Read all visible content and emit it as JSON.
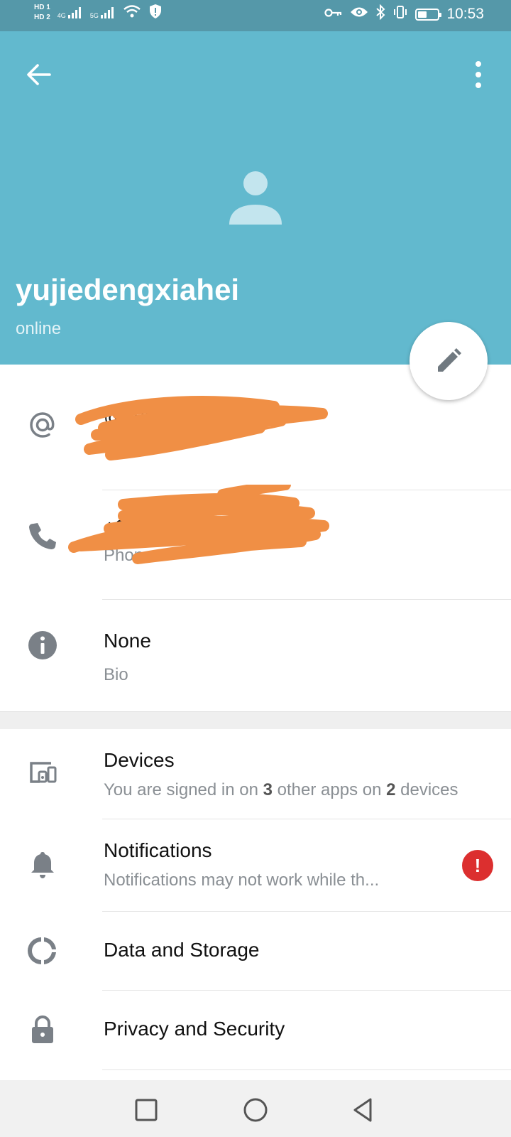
{
  "status_bar": {
    "time": "10:53",
    "hd1": "HD 1",
    "hd2": "HD 2",
    "net1": "4G",
    "net2": "5G"
  },
  "profile": {
    "display_name": "yujiedengxiahei",
    "status": "online"
  },
  "info": {
    "username_value": "@yujiedengxiahei",
    "username_label": "Username",
    "phone_value": "+86 000 0000 0000",
    "phone_label": "Phone",
    "bio_value": "None",
    "bio_label": "Bio"
  },
  "settings": {
    "devices_title": "Devices",
    "devices_sub_prefix": "You are signed in on ",
    "devices_apps": "3",
    "devices_sub_mid": " other apps on ",
    "devices_count": "2",
    "devices_sub_suffix": " devices",
    "notifications_title": "Notifications",
    "notifications_sub": "Notifications may not work while th...",
    "notifications_badge": "!",
    "data_storage_title": "Data and Storage",
    "privacy_title": "Privacy and Security"
  },
  "icons": {
    "back": "arrow-back-icon",
    "more": "more-vertical-icon",
    "avatar": "person-icon",
    "edit": "pencil-icon",
    "username": "at-sign-icon",
    "phone": "phone-icon",
    "bio": "info-icon",
    "devices": "devices-icon",
    "notifications": "bell-icon",
    "data": "pie-chart-icon",
    "privacy": "lock-icon"
  },
  "colors": {
    "header": "#62b9ce",
    "status_bar": "#5598a9",
    "badge": "#dc2f2f",
    "scribble": "#f08f45"
  }
}
